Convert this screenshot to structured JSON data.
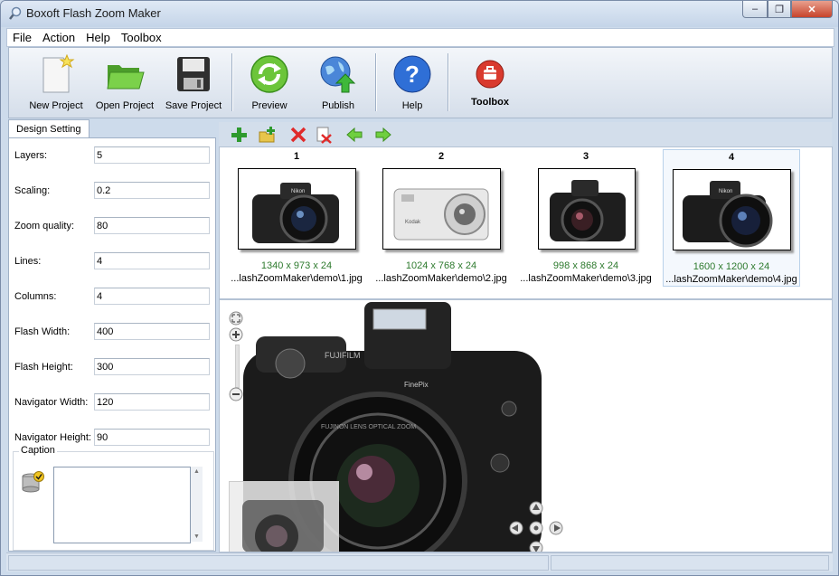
{
  "window": {
    "title": "Boxoft Flash Zoom Maker"
  },
  "menu": [
    "File",
    "Action",
    "Help",
    "Toolbox"
  ],
  "toolbar": {
    "new_project": "New Project",
    "open_project": "Open Project",
    "save_project": "Save Project",
    "preview": "Preview",
    "publish": "Publish",
    "help": "Help",
    "toolbox": "Toolbox"
  },
  "design": {
    "tab": "Design Setting",
    "fields": [
      {
        "label": "Layers:",
        "value": "5"
      },
      {
        "label": "Scaling:",
        "value": "0.2"
      },
      {
        "label": "Zoom quality:",
        "value": "80"
      },
      {
        "label": "Lines:",
        "value": "4"
      },
      {
        "label": "Columns:",
        "value": "4"
      },
      {
        "label": "Flash Width:",
        "value": "400"
      },
      {
        "label": "Flash Height:",
        "value": "300"
      },
      {
        "label": "Navigator Width:",
        "value": "120"
      },
      {
        "label": "Navigator Height:",
        "value": "90"
      }
    ],
    "caption_label": "Caption",
    "caption_value": ""
  },
  "images": [
    {
      "num": "1",
      "dims": "1340 x 973 x 24",
      "path": "...lashZoomMaker\\demo\\1.jpg",
      "selected": false
    },
    {
      "num": "2",
      "dims": "1024 x 768 x 24",
      "path": "...lashZoomMaker\\demo\\2.jpg",
      "selected": false
    },
    {
      "num": "3",
      "dims": "998 x 868 x 24",
      "path": "...lashZoomMaker\\demo\\3.jpg",
      "selected": false
    },
    {
      "num": "4",
      "dims": "1600 x 1200 x 24",
      "path": "...lashZoomMaker\\demo\\4.jpg",
      "selected": true
    }
  ],
  "icons": {
    "add": "plus-icon",
    "add_folder": "add-folder-icon",
    "delete": "delete-icon",
    "clear": "clear-list-icon",
    "move_left": "arrow-left-icon",
    "move_right": "arrow-right-icon"
  },
  "colors": {
    "green_text": "#2d7a2d",
    "title_bg": "#c4d4e8",
    "close_btn": "#c7432b"
  }
}
